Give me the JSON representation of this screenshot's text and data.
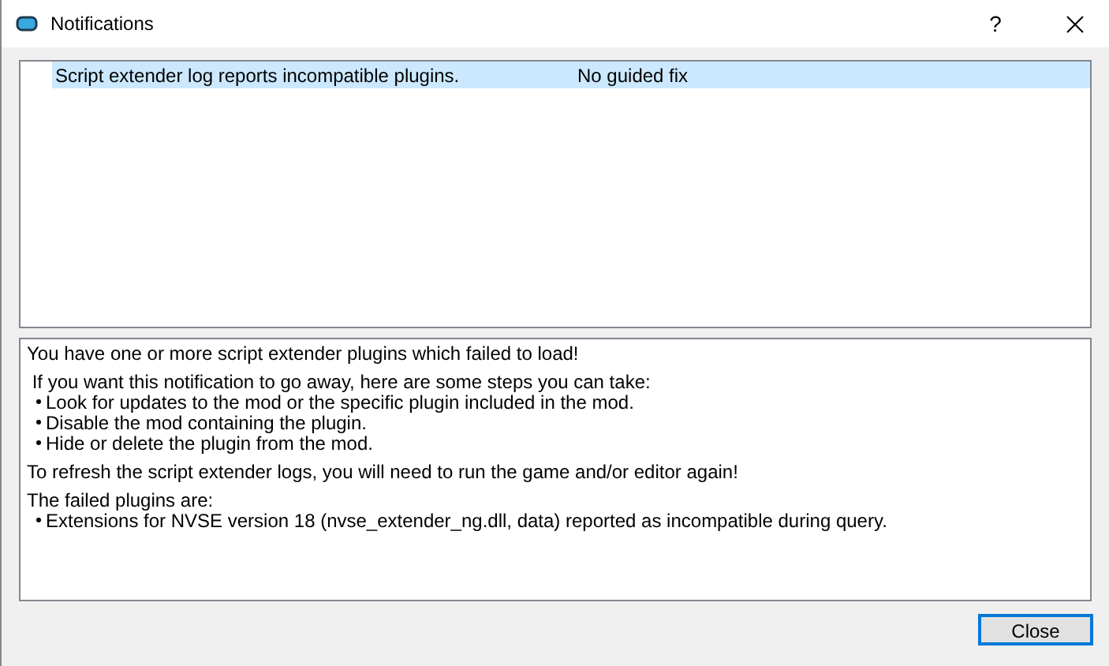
{
  "window": {
    "title": "Notifications",
    "help": "?"
  },
  "notifications": [
    {
      "message": "Script extender log reports incompatible plugins.",
      "fix": "No guided fix",
      "selected": true
    }
  ],
  "details": [
    {
      "kind": "line",
      "text": "You have one or more script extender plugins which failed to load!"
    },
    {
      "kind": "line",
      "text": " If you want this notification to go away, here are some steps you can take:"
    },
    {
      "kind": "bullet",
      "text": "Look for updates to the mod or the specific plugin included in the mod."
    },
    {
      "kind": "bullet",
      "text": "Disable the mod containing the plugin."
    },
    {
      "kind": "bullet",
      "text": "Hide or delete the plugin from the mod."
    },
    {
      "kind": "line",
      "text": "To refresh the script extender logs, you will need to run the game and/or editor again!"
    },
    {
      "kind": "line",
      "text": "The failed plugins are:"
    },
    {
      "kind": "bullet",
      "text": "Extensions for NVSE version 18 (nvse_extender_ng.dll, data) reported as incompatible during query."
    }
  ],
  "buttons": [
    "Close"
  ]
}
